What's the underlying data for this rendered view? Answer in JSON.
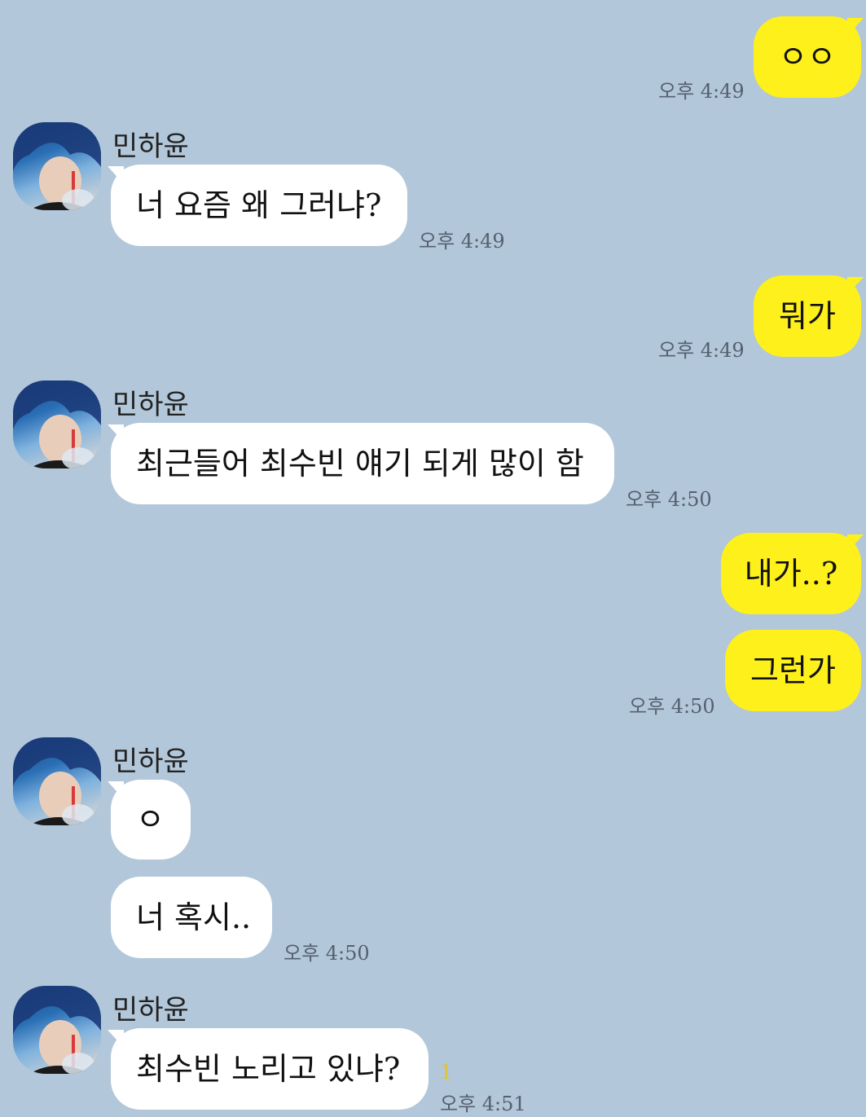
{
  "colors": {
    "background": "#b2c7d9",
    "my_bubble": "#fef01b",
    "their_bubble": "#ffffff",
    "timestamp": "#556070",
    "unread": "#e3c42a"
  },
  "messages": [
    {
      "from": "me",
      "text": "ㅇㅇ",
      "time": "오후 4:49"
    },
    {
      "from": "them",
      "sender": "민하윤",
      "text": "너 요즘 왜 그러냐?",
      "time": "오후 4:49"
    },
    {
      "from": "me",
      "text": "뭐가",
      "time": "오후 4:49"
    },
    {
      "from": "them",
      "sender": "민하윤",
      "text": "최근들어 최수빈 얘기 되게 많이 함",
      "time": "오후 4:50"
    },
    {
      "from": "me",
      "text": "내가..?"
    },
    {
      "from": "me",
      "text": "그런가",
      "time": "오후 4:50"
    },
    {
      "from": "them",
      "sender": "민하윤",
      "text": "ㅇ"
    },
    {
      "from": "them",
      "text": "너 혹시..",
      "time": "오후 4:50"
    },
    {
      "from": "them",
      "sender": "민하윤",
      "text": "최수빈 노리고 있냐?",
      "time": "오후 4:51",
      "unread": "1"
    }
  ],
  "avatar_icon": "profile-photo"
}
